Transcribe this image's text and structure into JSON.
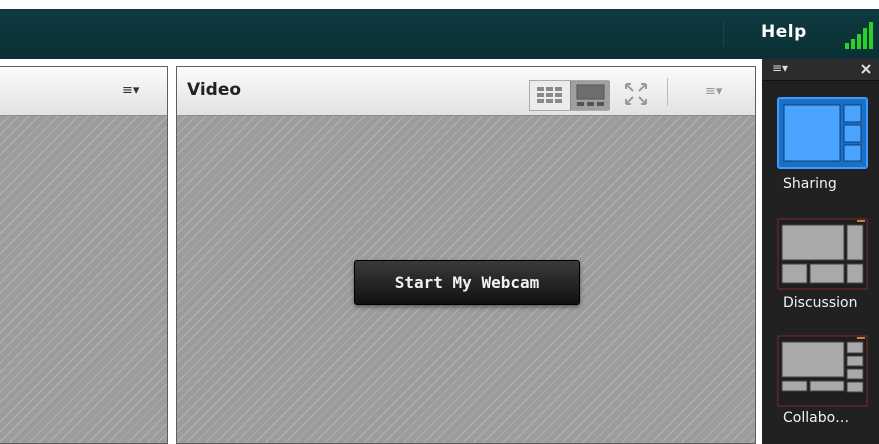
{
  "topbar": {
    "help_label": "Help"
  },
  "left_pod": {
    "menu_icon": "hamburger-menu-icon"
  },
  "video_pod": {
    "title": "Video",
    "start_webcam_label": "Start My Webcam"
  },
  "layouts": {
    "items": [
      {
        "label": "Sharing",
        "selected": true
      },
      {
        "label": "Discussion",
        "selected": false
      },
      {
        "label": "Collabo…",
        "selected": false
      }
    ]
  },
  "colors": {
    "topbar": "#0e3a3f",
    "signal": "#2ad12a",
    "selected_layout": "#1b7ee0",
    "strip": "#212121"
  }
}
